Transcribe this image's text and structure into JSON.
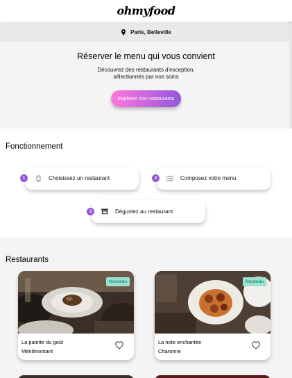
{
  "header": {
    "logo": "ohmyfood"
  },
  "location": {
    "icon": "map-pin-icon",
    "text": "Paris, Belleville"
  },
  "hero": {
    "title": "Réserver le menu qui vous convient",
    "subtitle_line1": "Découvrez des restaurants d'exception,",
    "subtitle_line2": "sélectionnés par nos soins",
    "cta_label": "Explorer nos restaurants"
  },
  "how": {
    "title": "Fonctionnement",
    "steps": [
      {
        "num": "1",
        "icon": "phone-icon",
        "label": "Choisissez un restaurant"
      },
      {
        "num": "2",
        "icon": "list-icon",
        "label": "Composez votre menu"
      },
      {
        "num": "3",
        "icon": "store-icon",
        "label": "Dégustez au restaurant"
      }
    ]
  },
  "restaurants": {
    "title": "Restaurants",
    "items": [
      {
        "badge": "Nouveau",
        "name": "La palette du goût",
        "area": "Ménilmontant"
      },
      {
        "badge": "Nouveau",
        "name": "La note enchantée",
        "area": "Charonne"
      }
    ]
  },
  "colors": {
    "accent": "#9356dc",
    "gradient_start": "#ff79da",
    "badge_bg": "#99e2d0",
    "badge_text": "#0b6b53"
  }
}
